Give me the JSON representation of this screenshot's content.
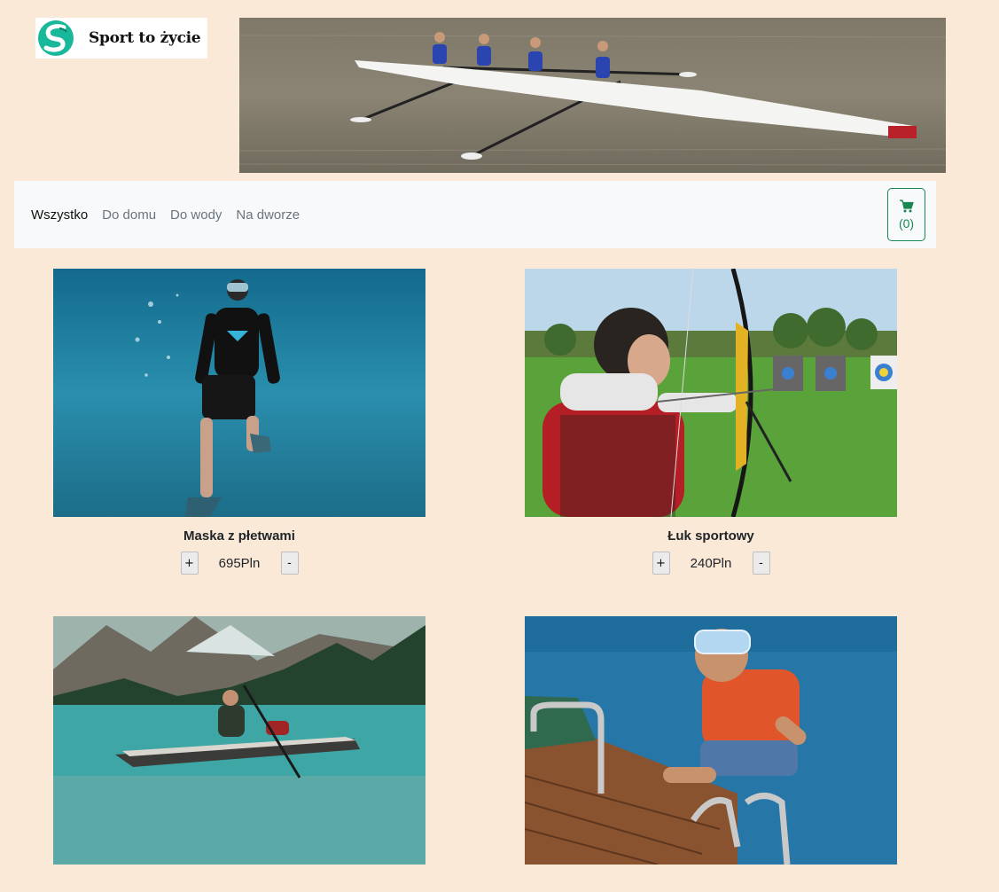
{
  "header": {
    "brand": "Sport to życie"
  },
  "nav": {
    "items": [
      {
        "label": "Wszystko",
        "active": true
      },
      {
        "label": "Do domu",
        "active": false
      },
      {
        "label": "Do wody",
        "active": false
      },
      {
        "label": "Na dworze",
        "active": false
      }
    ],
    "cart_count": "(0)"
  },
  "products": [
    {
      "name": "Maska z płetwami",
      "price": "695Pln",
      "plus": "+",
      "minus": "-"
    },
    {
      "name": "Łuk sportowy",
      "price": "240Pln",
      "plus": "+",
      "minus": "-"
    },
    {
      "name": "",
      "price": "",
      "plus": "+",
      "minus": "-"
    },
    {
      "name": "",
      "price": "",
      "plus": "+",
      "minus": "-"
    }
  ],
  "colors": {
    "page_background": "#fae9d7",
    "navbar_background": "#f8f9fa",
    "cart_accent": "#198754",
    "logo_teal": "#18b89a"
  },
  "icons": {
    "cart": "shopping-cart-icon",
    "logo": "logo-s-icon"
  }
}
